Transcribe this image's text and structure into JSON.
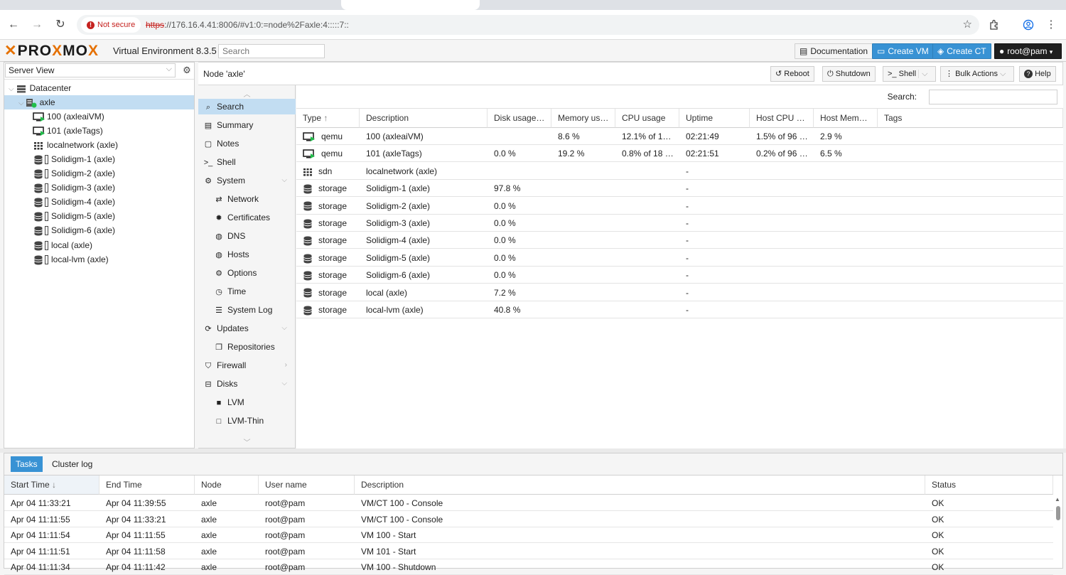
{
  "browser": {
    "url_scheme": "https",
    "url_rest": "://176.16.4.41:8006/#v1:0:=node%2Faxle:4:::::7::",
    "security_label": "Not secure"
  },
  "pve_header": {
    "logo_text": [
      "X",
      "PRO",
      "X",
      "MO",
      "X"
    ],
    "version": "Virtual Environment 8.3.5",
    "search_placeholder": "Search",
    "buttons": {
      "documentation": "Documentation",
      "create_vm": "Create VM",
      "create_ct": "Create CT",
      "user": "root@pam"
    }
  },
  "tree": {
    "view": "Server View",
    "items": [
      {
        "label": "Datacenter",
        "icon": "server-stack-icon"
      },
      {
        "label": "axle",
        "icon": "node-online-icon"
      },
      {
        "label": "100 (axleaiVM)",
        "icon": "vm-running-icon"
      },
      {
        "label": "101 (axleTags)",
        "icon": "vm-running-icon"
      },
      {
        "label": "localnetwork (axle)",
        "icon": "sdn-grid-icon"
      },
      {
        "label": "Solidigm-1 (axle)",
        "icon": "storage-icon"
      },
      {
        "label": "Solidigm-2 (axle)",
        "icon": "storage-icon"
      },
      {
        "label": "Solidigm-3 (axle)",
        "icon": "storage-icon"
      },
      {
        "label": "Solidigm-4 (axle)",
        "icon": "storage-icon"
      },
      {
        "label": "Solidigm-5 (axle)",
        "icon": "storage-icon"
      },
      {
        "label": "Solidigm-6 (axle)",
        "icon": "storage-icon"
      },
      {
        "label": "local (axle)",
        "icon": "storage-icon"
      },
      {
        "label": "local-lvm (axle)",
        "icon": "storage-icon"
      }
    ]
  },
  "content": {
    "title": "Node 'axle'",
    "toolbar": {
      "reboot": "Reboot",
      "shutdown": "Shutdown",
      "shell": "Shell",
      "bulk": "Bulk Actions",
      "help": "Help"
    }
  },
  "nav": {
    "items": [
      {
        "label": "Search",
        "icon": "search-icon"
      },
      {
        "label": "Summary",
        "icon": "book-icon"
      },
      {
        "label": "Notes",
        "icon": "note-icon"
      },
      {
        "label": "Shell",
        "icon": "terminal-icon"
      },
      {
        "label": "System",
        "icon": "cogs-icon"
      },
      {
        "label": "Network",
        "icon": "exchange-icon"
      },
      {
        "label": "Certificates",
        "icon": "certificate-icon"
      },
      {
        "label": "DNS",
        "icon": "globe-icon"
      },
      {
        "label": "Hosts",
        "icon": "globe-icon"
      },
      {
        "label": "Options",
        "icon": "gear-icon"
      },
      {
        "label": "Time",
        "icon": "clock-icon"
      },
      {
        "label": "System Log",
        "icon": "list-icon"
      },
      {
        "label": "Updates",
        "icon": "refresh-icon"
      },
      {
        "label": "Repositories",
        "icon": "files-icon"
      },
      {
        "label": "Firewall",
        "icon": "shield-icon"
      },
      {
        "label": "Disks",
        "icon": "hdd-icon"
      },
      {
        "label": "LVM",
        "icon": "square-icon"
      },
      {
        "label": "LVM-Thin",
        "icon": "square-outline-icon"
      }
    ]
  },
  "search_grid": {
    "search_label": "Search:",
    "columns": [
      "Type",
      "Description",
      "Disk usage…",
      "Memory us…",
      "CPU usage",
      "Uptime",
      "Host CPU …",
      "Host Mem…",
      "Tags"
    ],
    "rows": [
      {
        "type": "qemu",
        "desc": "100 (axleaiVM)",
        "disk": "",
        "mem": "8.6 %",
        "cpu": "12.1% of 1…",
        "uptime": "02:21:49",
        "hcpu": "1.5% of 96 …",
        "hmem": "2.9 %",
        "tags": ""
      },
      {
        "type": "qemu",
        "desc": "101 (axleTags)",
        "disk": "0.0 %",
        "mem": "19.2 %",
        "cpu": "0.8% of 18 …",
        "uptime": "02:21:51",
        "hcpu": "0.2% of 96 …",
        "hmem": "6.5 %",
        "tags": ""
      },
      {
        "type": "sdn",
        "desc": "localnetwork (axle)",
        "disk": "",
        "mem": "",
        "cpu": "",
        "uptime": "-",
        "hcpu": "",
        "hmem": "",
        "tags": ""
      },
      {
        "type": "storage",
        "desc": "Solidigm-1 (axle)",
        "disk": "97.8 %",
        "mem": "",
        "cpu": "",
        "uptime": "-",
        "hcpu": "",
        "hmem": "",
        "tags": ""
      },
      {
        "type": "storage",
        "desc": "Solidigm-2 (axle)",
        "disk": "0.0 %",
        "mem": "",
        "cpu": "",
        "uptime": "-",
        "hcpu": "",
        "hmem": "",
        "tags": ""
      },
      {
        "type": "storage",
        "desc": "Solidigm-3 (axle)",
        "disk": "0.0 %",
        "mem": "",
        "cpu": "",
        "uptime": "-",
        "hcpu": "",
        "hmem": "",
        "tags": ""
      },
      {
        "type": "storage",
        "desc": "Solidigm-4 (axle)",
        "disk": "0.0 %",
        "mem": "",
        "cpu": "",
        "uptime": "-",
        "hcpu": "",
        "hmem": "",
        "tags": ""
      },
      {
        "type": "storage",
        "desc": "Solidigm-5 (axle)",
        "disk": "0.0 %",
        "mem": "",
        "cpu": "",
        "uptime": "-",
        "hcpu": "",
        "hmem": "",
        "tags": ""
      },
      {
        "type": "storage",
        "desc": "Solidigm-6 (axle)",
        "disk": "0.0 %",
        "mem": "",
        "cpu": "",
        "uptime": "-",
        "hcpu": "",
        "hmem": "",
        "tags": ""
      },
      {
        "type": "storage",
        "desc": "local (axle)",
        "disk": "7.2 %",
        "mem": "",
        "cpu": "",
        "uptime": "-",
        "hcpu": "",
        "hmem": "",
        "tags": ""
      },
      {
        "type": "storage",
        "desc": "local-lvm (axle)",
        "disk": "40.8 %",
        "mem": "",
        "cpu": "",
        "uptime": "-",
        "hcpu": "",
        "hmem": "",
        "tags": ""
      }
    ]
  },
  "bottom": {
    "tabs": [
      "Tasks",
      "Cluster log"
    ],
    "columns": [
      "Start Time",
      "End Time",
      "Node",
      "User name",
      "Description",
      "Status"
    ],
    "rows": [
      {
        "start": "Apr 04 11:33:21",
        "end": "Apr 04 11:39:55",
        "node": "axle",
        "user": "root@pam",
        "desc": "VM/CT 100 - Console",
        "status": "OK"
      },
      {
        "start": "Apr 04 11:11:55",
        "end": "Apr 04 11:33:21",
        "node": "axle",
        "user": "root@pam",
        "desc": "VM/CT 100 - Console",
        "status": "OK"
      },
      {
        "start": "Apr 04 11:11:54",
        "end": "Apr 04 11:11:55",
        "node": "axle",
        "user": "root@pam",
        "desc": "VM 100 - Start",
        "status": "OK"
      },
      {
        "start": "Apr 04 11:11:51",
        "end": "Apr 04 11:11:58",
        "node": "axle",
        "user": "root@pam",
        "desc": "VM 101 - Start",
        "status": "OK"
      },
      {
        "start": "Apr 04 11:11:34",
        "end": "Apr 04 11:11:42",
        "node": "axle",
        "user": "root@pam",
        "desc": "VM 100 - Shutdown",
        "status": "OK"
      }
    ]
  },
  "colors": {
    "accent": "#3892d4",
    "selection": "#c2ddf2",
    "brand_orange": "#e57000",
    "running_green": "#21bf4b"
  }
}
